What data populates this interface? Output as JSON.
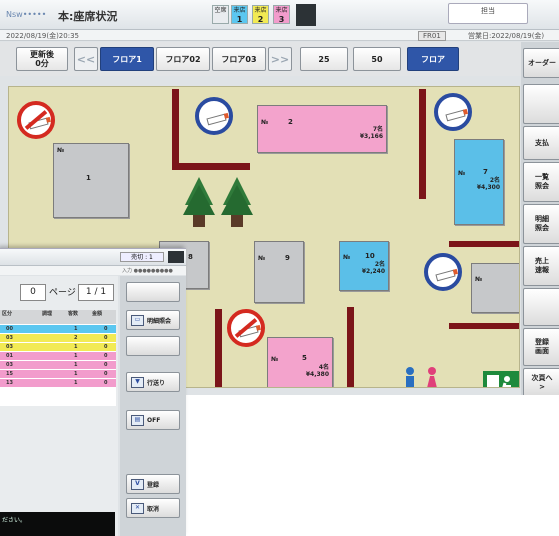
{
  "main": {
    "logo": "Nsw•••••",
    "title": "本:座席状況",
    "status_boxes": [
      {
        "label": "空席",
        "value": "",
        "color": "#e9ecef"
      },
      {
        "label": "来店",
        "value": "1",
        "color": "#5bc7f0"
      },
      {
        "label": "来店",
        "value": "2",
        "color": "#f2ea54"
      },
      {
        "label": "来店",
        "value": "3",
        "color": "#f29ccc"
      }
    ],
    "message_box": "担当",
    "datetime": "2022/08/19(金)20:35",
    "info_right_label": "FR01",
    "business_date": "営業日:2022/08/19(金)",
    "toolbar": {
      "update_button": "更新後\n0分",
      "prev_label": "<<",
      "floors": [
        "フロア1",
        "フロア02",
        "フロア03"
      ],
      "next_label": ">>",
      "options": [
        "25",
        "50"
      ],
      "selected_option": "フロア"
    },
    "right_panel": [
      "オーダー",
      "",
      "支払",
      "一覧\n照会",
      "明細\n照会",
      "売上\n速報",
      "",
      "登録\n画面",
      "次頁へ\n>"
    ],
    "tables": [
      {
        "no": "№",
        "num": "1",
        "amount": "",
        "color": "gray"
      },
      {
        "no": "№",
        "num": "2",
        "amount": "7名\n¥3,166",
        "color": "pink"
      },
      {
        "no": "№",
        "num": "7",
        "amount": "2名\n¥4,300",
        "color": "blue"
      },
      {
        "no": "№",
        "num": "8",
        "amount": "",
        "color": "gray"
      },
      {
        "no": "№",
        "num": "9",
        "amount": "",
        "color": "gray"
      },
      {
        "no": "№",
        "num": "10",
        "amount": "2名\n¥2,240",
        "color": "blue"
      },
      {
        "no": "№",
        "num": "",
        "amount": "",
        "color": "gray"
      },
      {
        "no": "№",
        "num": "5",
        "amount": "4名\n¥4,380",
        "color": "pink"
      }
    ]
  },
  "sub": {
    "header_mid": "売切 : 1",
    "header_info": "入力 ●●●●●●●●●",
    "page_value": "0",
    "page_label": "ページ",
    "page_current": "1 /",
    "page_total": "1",
    "columns": [
      "区分",
      "調理",
      "客数",
      "金額"
    ],
    "rows": [
      {
        "time": "00",
        "qty": "1",
        "amount": "0",
        "color": "#5bc7f0"
      },
      {
        "time": "03",
        "qty": "2",
        "amount": "0",
        "color": "#f2ea54"
      },
      {
        "time": "03",
        "qty": "1",
        "amount": "0",
        "color": "#f2ea54"
      },
      {
        "time": "01",
        "qty": "1",
        "amount": "0",
        "color": "#f29ccc"
      },
      {
        "time": "03",
        "qty": "1",
        "amount": "0",
        "color": "#f29ccc"
      },
      {
        "time": "15",
        "qty": "1",
        "amount": "0",
        "color": "#f29ccc"
      },
      {
        "time": "13",
        "qty": "1",
        "amount": "0",
        "color": "#f29ccc"
      },
      {
        "time": "",
        "qty": "",
        "amount": "",
        "color": "#ffffff"
      },
      {
        "time": "",
        "qty": "",
        "amount": "",
        "color": "#ffffff"
      }
    ],
    "note": "ださい。",
    "buttons": [
      "明細照会",
      "行送り",
      "OFF",
      "登録",
      "取消"
    ]
  }
}
